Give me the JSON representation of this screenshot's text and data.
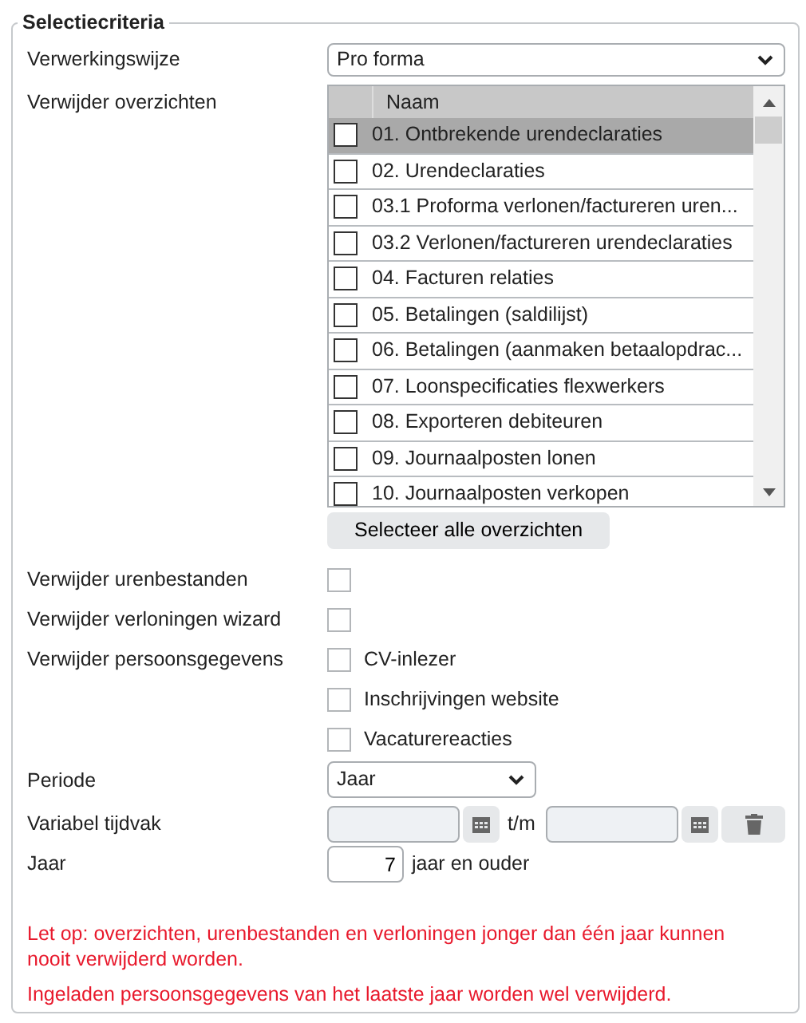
{
  "legend": "Selectiecriteria",
  "processing": {
    "label": "Verwerkingswijze",
    "value": "Pro forma"
  },
  "overviews": {
    "label": "Verwijder overzichten",
    "column": "Naam",
    "rows": [
      {
        "name": "01. Ontbrekende urendeclaraties",
        "checked": false,
        "selected": true
      },
      {
        "name": "02. Urendeclaraties",
        "checked": false,
        "selected": false
      },
      {
        "name": "03.1 Proforma verlonen/factureren uren...",
        "checked": false,
        "selected": false
      },
      {
        "name": "03.2 Verlonen/factureren urendeclaraties",
        "checked": false,
        "selected": false
      },
      {
        "name": "04. Facturen relaties",
        "checked": false,
        "selected": false
      },
      {
        "name": "05. Betalingen (saldilijst)",
        "checked": false,
        "selected": false
      },
      {
        "name": "06. Betalingen (aanmaken betaalopdrac...",
        "checked": false,
        "selected": false
      },
      {
        "name": "07. Loonspecificaties flexwerkers",
        "checked": false,
        "selected": false
      },
      {
        "name": "08. Exporteren debiteuren",
        "checked": false,
        "selected": false
      },
      {
        "name": "09. Journaalposten lonen",
        "checked": false,
        "selected": false
      },
      {
        "name": "10. Journaalposten verkopen",
        "checked": false,
        "selected": false
      }
    ],
    "select_all": "Selecteer alle overzichten"
  },
  "checks": [
    {
      "label": "Verwijder urenbestanden",
      "options": [
        {
          "checked": false
        }
      ]
    },
    {
      "label": "Verwijder verloningen wizard",
      "options": [
        {
          "checked": false
        }
      ]
    },
    {
      "label": "Verwijder persoonsgegevens",
      "options": [
        {
          "text": "CV-inlezer",
          "checked": false
        },
        {
          "text": "Inschrijvingen website",
          "checked": false
        },
        {
          "text": "Vacaturereacties",
          "checked": false
        }
      ]
    }
  ],
  "period": {
    "label": "Periode",
    "value": "Jaar"
  },
  "variable": {
    "label": "Variabel tijdvak",
    "separator": "t/m"
  },
  "year": {
    "label": "Jaar",
    "value": "7",
    "suffix": "jaar en ouder"
  },
  "notes": [
    "Let op: overzichten, urenbestanden en verloningen jonger dan één jaar kunnen nooit verwijderd worden.",
    "Ingeladen persoonsgegevens van het laatste jaar worden wel verwijderd."
  ]
}
